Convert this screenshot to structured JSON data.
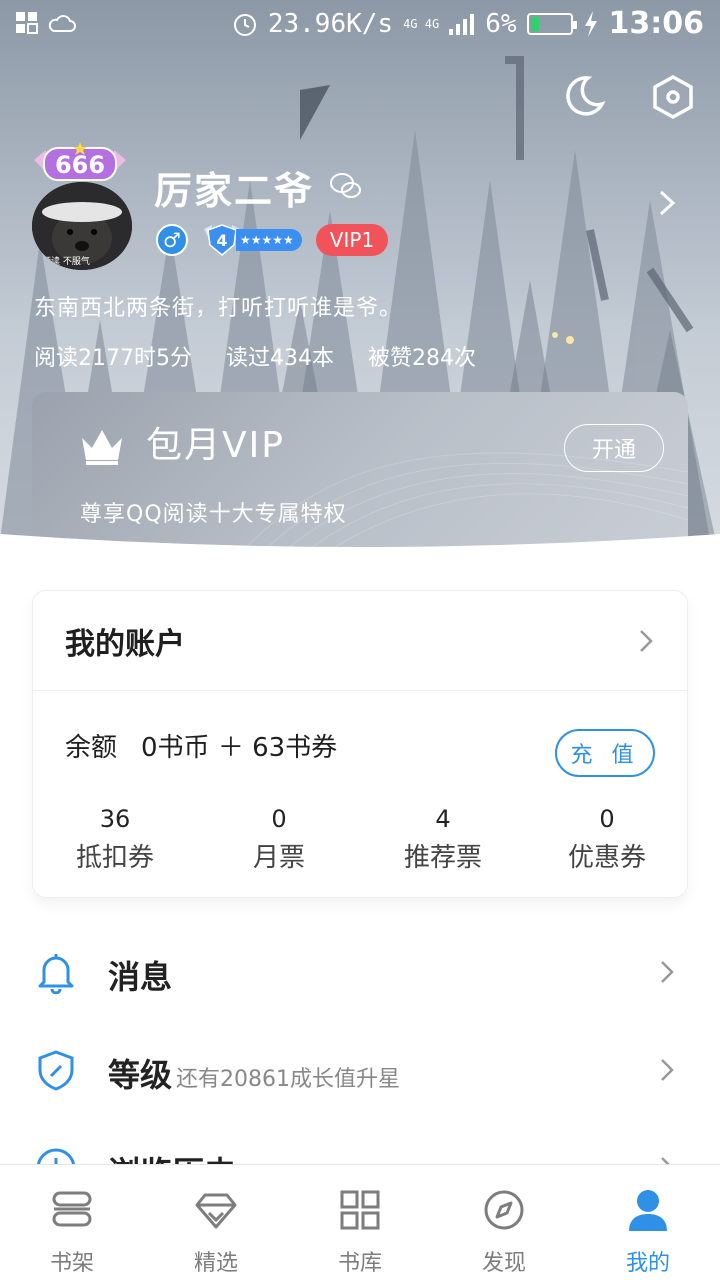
{
  "status_bar": {
    "speed": "23.96K/s",
    "network": "4G 4G",
    "battery": "6%",
    "time": "13:06"
  },
  "profile": {
    "avatar_badge": "666",
    "avatar_caption": "洒读 不服气",
    "username": "厉家二爷",
    "gender_symbol": "♂",
    "level_number": "4",
    "level_stars": "★★★★★",
    "vip_level": "VIP1",
    "motto": "东南西北两条街，打听打听谁是爷。",
    "stats": {
      "read_time": "阅读2177时5分",
      "books_read": "读过434本",
      "likes": "被赞284次"
    }
  },
  "vip_card": {
    "title": "包月VIP",
    "subtitle": "尊享QQ阅读十大专属特权",
    "button": "开通"
  },
  "account": {
    "title": "我的账户",
    "balance_label": "余额",
    "balance_value": "0书币 ＋ 63书券",
    "recharge_button": "充 值",
    "items": [
      {
        "number": "36",
        "label": "抵扣券"
      },
      {
        "number": "0",
        "label": "月票"
      },
      {
        "number": "4",
        "label": "推荐票"
      },
      {
        "number": "0",
        "label": "优惠券"
      }
    ]
  },
  "menu": {
    "messages": "消息",
    "level": "等级",
    "level_hint": "还有20861成长值升星",
    "history": "浏览历史"
  },
  "tabs": [
    {
      "label": "书架",
      "icon": "bookshelf-icon"
    },
    {
      "label": "精选",
      "icon": "diamond-icon"
    },
    {
      "label": "书库",
      "icon": "grid-icon"
    },
    {
      "label": "发现",
      "icon": "compass-icon"
    },
    {
      "label": "我的",
      "icon": "user-icon",
      "active": true
    }
  ],
  "colors": {
    "accent": "#2f90e8",
    "vip_red": "#f2525a",
    "tab_inactive": "#7d7d7d"
  }
}
